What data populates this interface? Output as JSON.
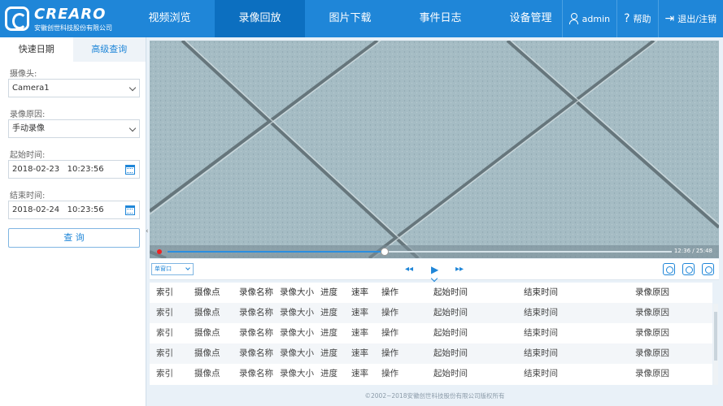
{
  "brand": {
    "logo_text": "CREARO",
    "company": "安徽创世科技股份有限公司"
  },
  "nav": {
    "items": [
      {
        "label": "视频浏览"
      },
      {
        "label": "录像回放"
      },
      {
        "label": "图片下载"
      },
      {
        "label": "事件日志"
      },
      {
        "label": "设备管理"
      }
    ],
    "active_index": 1
  },
  "user": {
    "username": "admin",
    "help_label": "帮助",
    "logout_label": "退出/注销"
  },
  "search_panel": {
    "tabs": [
      "快速日期",
      "高级查询"
    ],
    "active_tab": "快速日期",
    "camera_label": "摄像头:",
    "camera_value": "Camera1",
    "reason_label": "录像原因:",
    "reason_value": "手动录像",
    "start_label": "起始时间:",
    "start_value": "2018-02-23   10:23:56",
    "end_label": "结束时间:",
    "end_value": "2018-02-24   10:23:56",
    "query_label": "查 询"
  },
  "player": {
    "progress": 0.43,
    "time_readout": "12:36 / 25:48",
    "window_mode": "单窗口",
    "icons": [
      "rewind-icon",
      "play-icon",
      "fast-forward-icon",
      "record-icon",
      "snapshot-icon",
      "fullscreen-icon"
    ]
  },
  "table": {
    "headers": [
      "索引",
      "摄像点",
      "录像名称",
      "录像大小",
      "进度",
      "速率",
      "操作",
      "起始时间",
      "结束时间",
      "录像原因"
    ],
    "rows": [
      [
        "索引",
        "摄像点",
        "录像名称",
        "录像大小",
        "进度",
        "速率",
        "操作",
        "起始时间",
        "结束时间",
        "录像原因"
      ],
      [
        "索引",
        "摄像点",
        "录像名称",
        "录像大小",
        "进度",
        "速率",
        "操作",
        "起始时间",
        "结束时间",
        "录像原因"
      ],
      [
        "索引",
        "摄像点",
        "录像名称",
        "录像大小",
        "进度",
        "速率",
        "操作",
        "起始时间",
        "结束时间",
        "录像原因"
      ],
      [
        "索引",
        "摄像点",
        "录像名称",
        "录像大小",
        "进度",
        "速率",
        "操作",
        "起始时间",
        "结束时间",
        "录像原因"
      ]
    ]
  },
  "footer": {
    "copyright": "©2002~2018安徽创世科技股份有限公司版权所有"
  },
  "colors": {
    "primary": "#1f86d8",
    "nav_active": "#0c6fc0",
    "record": "#e22222"
  }
}
